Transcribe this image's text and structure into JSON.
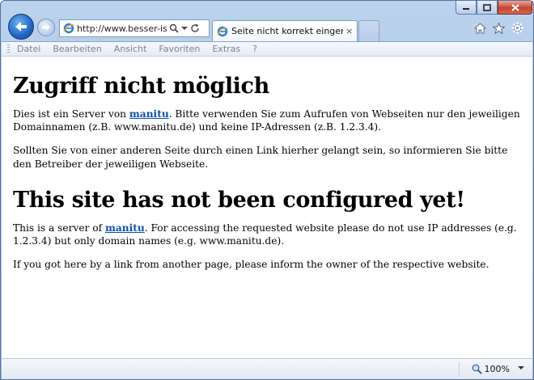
{
  "browser": {
    "address_url": "http://www.besser-ist...",
    "tab_title": "Seite nicht korrekt eingeric...",
    "tab_close": "×"
  },
  "menu": [
    "Datei",
    "Bearbeiten",
    "Ansicht",
    "Favoriten",
    "Extras",
    "?"
  ],
  "page": {
    "heading_de": "Zugriff nicht möglich",
    "p1_before": "Dies ist ein Server von ",
    "p1_link": "manitu",
    "p1_after": ". Bitte verwenden Sie zum Aufrufen von Webseiten nur den jeweiligen Domainnamen (z.B. www.manitu.de) und keine IP-Adressen (z.B. 1.2.3.4).",
    "p2": "Sollten Sie von einer anderen Seite durch einen Link hierher gelangt sein, so informieren Sie bitte den Betreiber der jeweiligen Webseite.",
    "heading_en": "This site has not been configured yet!",
    "p3_before": "This is a server of ",
    "p3_link": "manitu",
    "p3_after": ". For accessing the requested website please do not use IP addresses (e.g. 1.2.3.4) but only domain names (e.g. www.manitu.de).",
    "p4": "If you got here by a link from another page, please inform the owner of the respective website."
  },
  "status": {
    "zoom": "100%"
  },
  "colors": {
    "link": "#0b4eaf",
    "frame": "#a9c3e6",
    "close_button": "#c7442e"
  },
  "icons": [
    "back-arrow-icon",
    "forward-arrow-icon",
    "ie-logo-icon",
    "search-icon",
    "dropdown-icon",
    "refresh-icon",
    "home-icon",
    "favorites-star-icon",
    "tools-gear-icon",
    "minimize-icon",
    "maximize-icon",
    "close-icon",
    "zoom-icon"
  ]
}
